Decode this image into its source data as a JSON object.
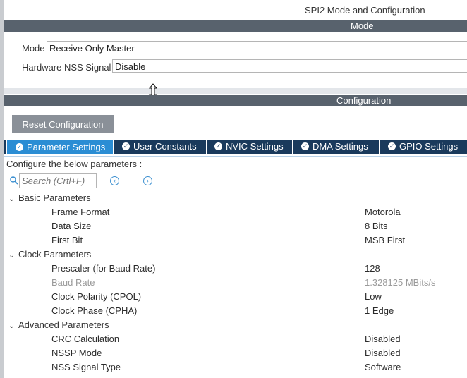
{
  "header": {
    "title": "SPI2 Mode and Configuration"
  },
  "mode_section": {
    "title": "Mode",
    "mode_label": "Mode",
    "mode_value": "Receive Only Master",
    "nss_label": "Hardware NSS Signal",
    "nss_value": "Disable"
  },
  "config_section": {
    "title": "Configuration",
    "reset_label": "Reset Configuration"
  },
  "tabs": [
    {
      "label": "Parameter Settings",
      "active": true
    },
    {
      "label": "User Constants",
      "active": false
    },
    {
      "label": "NVIC Settings",
      "active": false
    },
    {
      "label": "DMA Settings",
      "active": false
    },
    {
      "label": "GPIO Settings",
      "active": false
    }
  ],
  "info_text": "Configure the below parameters :",
  "search": {
    "placeholder": "Search (Crtl+F)"
  },
  "groups": [
    {
      "label": "Basic Parameters",
      "params": [
        {
          "name": "Frame Format",
          "value": "Motorola"
        },
        {
          "name": "Data Size",
          "value": "8 Bits"
        },
        {
          "name": "First Bit",
          "value": "MSB First"
        }
      ]
    },
    {
      "label": "Clock Parameters",
      "params": [
        {
          "name": "Prescaler (for Baud Rate)",
          "value": "128"
        },
        {
          "name": "Baud Rate",
          "value": "1.328125 MBits/s"
        },
        {
          "name": "Clock Polarity (CPOL)",
          "value": "Low"
        },
        {
          "name": "Clock Phase (CPHA)",
          "value": "1 Edge"
        }
      ]
    },
    {
      "label": "Advanced Parameters",
      "params": [
        {
          "name": "CRC Calculation",
          "value": "Disabled"
        },
        {
          "name": "NSSP Mode",
          "value": "Disabled"
        },
        {
          "name": "NSS Signal Type",
          "value": "Software"
        }
      ]
    }
  ],
  "colors": {
    "section_bar": "#58626d",
    "tab_strip": "#1a3a5c",
    "tab_active": "#2a8dd4",
    "reset_button": "#8a9098"
  }
}
